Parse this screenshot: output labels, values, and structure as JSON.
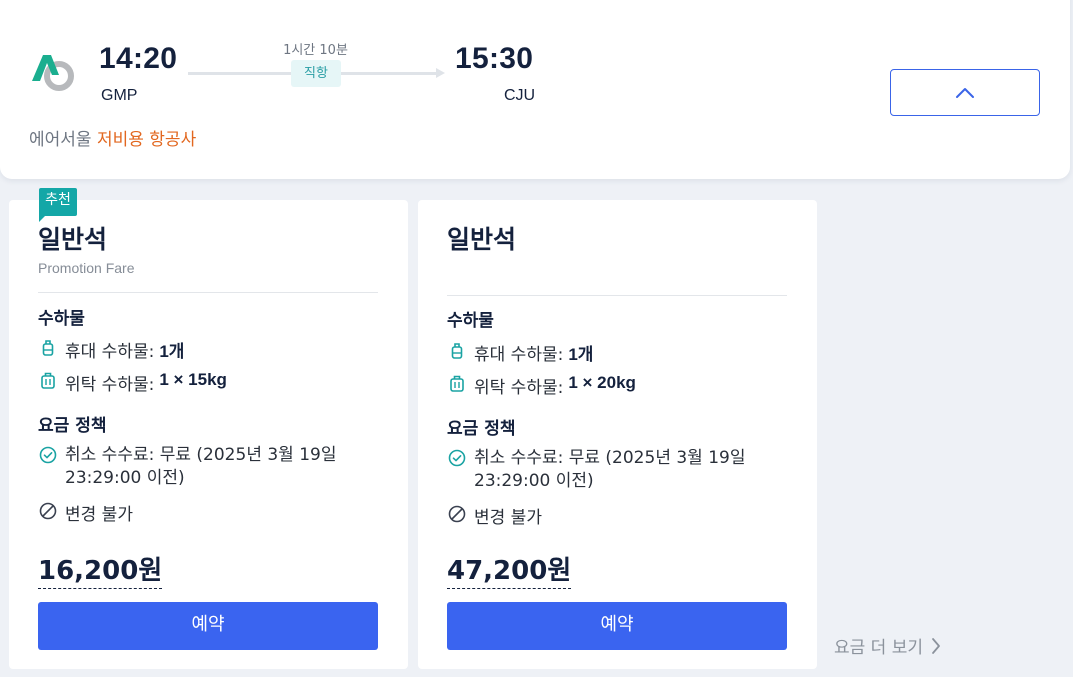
{
  "flight": {
    "departure_time": "14:20",
    "departure_airport": "GMP",
    "arrival_time": "15:30",
    "arrival_airport": "CJU",
    "duration": "1시간 10분",
    "direct_label": "직항",
    "airline": "에어서울",
    "airline_tag": "저비용 항공사",
    "collapse_icon": "chevron-up-icon"
  },
  "colors": {
    "primary": "#3a64f0",
    "recommend": "#14a7a7",
    "lcc_tag": "#e2671f",
    "direct_badge_text": "#2a9ea5"
  },
  "fares": [
    {
      "badge": "추천",
      "class_name": "일반석",
      "fare_type": "Promotion Fare",
      "baggage_title": "수하물",
      "carry_on_label": "휴대 수하물:",
      "carry_on_value": "1개",
      "checked_label": "위탁 수하물:",
      "checked_value": "1 × 15kg",
      "policy_title": "요금 정책",
      "cancel_fee": "취소 수수료: 무료 (2025년 3월 19일 23:29:00 이전)",
      "change_policy": "변경 불가",
      "price": "16,200원",
      "reserve_label": "예약"
    },
    {
      "badge": "",
      "class_name": "일반석",
      "fare_type": "",
      "baggage_title": "수하물",
      "carry_on_label": "휴대 수하물:",
      "carry_on_value": "1개",
      "checked_label": "위탁 수하물:",
      "checked_value": "1 × 20kg",
      "policy_title": "요금 정책",
      "cancel_fee": "취소 수수료: 무료 (2025년 3월 19일 23:29:00 이전)",
      "change_policy": "변경 불가",
      "price": "47,200원",
      "reserve_label": "예약"
    }
  ],
  "more_fares_label": "요금 더 보기"
}
